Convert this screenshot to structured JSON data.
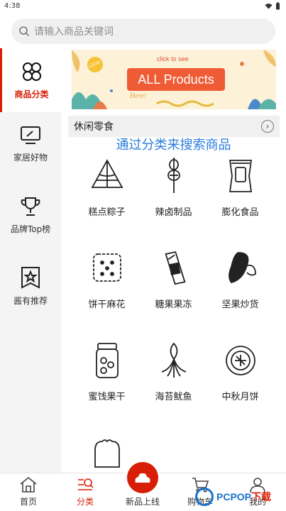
{
  "status_bar": {
    "time": "4:38"
  },
  "search": {
    "placeholder": "请输入商品关键词"
  },
  "sidebar": {
    "items": [
      {
        "label": "商品分类",
        "icon": "clover-icon",
        "active": true
      },
      {
        "label": "家居好物",
        "icon": "monitor-icon",
        "active": false
      },
      {
        "label": "品牌Top榜",
        "icon": "trophy-icon",
        "active": false
      },
      {
        "label": "酱有推荐",
        "icon": "star-badge-icon",
        "active": false
      }
    ]
  },
  "banner": {
    "button_text": "ALL Products",
    "click_text": "click to see",
    "look_text": "LOOK!",
    "here_text": "Here!"
  },
  "section": {
    "title": "休闲零食",
    "hint": "通过分类来搜索商品"
  },
  "categories": [
    {
      "label": "糕点粽子",
      "icon": "zongzi-icon"
    },
    {
      "label": "辣卤制品",
      "icon": "skewer-icon"
    },
    {
      "label": "膨化食品",
      "icon": "snack-bag-icon"
    },
    {
      "label": "饼干麻花",
      "icon": "biscuit-icon"
    },
    {
      "label": "糖果果冻",
      "icon": "candy-icon"
    },
    {
      "label": "坚果炒货",
      "icon": "nut-icon"
    },
    {
      "label": "蜜饯果干",
      "icon": "jar-icon"
    },
    {
      "label": "海苔鱿鱼",
      "icon": "squid-icon"
    },
    {
      "label": "中秋月饼",
      "icon": "mooncake-icon"
    },
    {
      "label": "",
      "icon": "bread-icon"
    }
  ],
  "tabbar": {
    "items": [
      {
        "label": "首页",
        "icon": "home-icon"
      },
      {
        "label": "分类",
        "icon": "category-icon",
        "active": true
      },
      {
        "label": "新品上线",
        "icon": "new-product-icon"
      },
      {
        "label": "购物车",
        "icon": "cart-icon"
      },
      {
        "label": "我的",
        "icon": "user-icon"
      }
    ]
  },
  "watermark": {
    "text_a": "PCPOP",
    "text_b": "下载"
  },
  "colors": {
    "accent": "#d81e06",
    "hint": "#2a7cdc",
    "sidebar_bg": "#f4f4f4"
  }
}
